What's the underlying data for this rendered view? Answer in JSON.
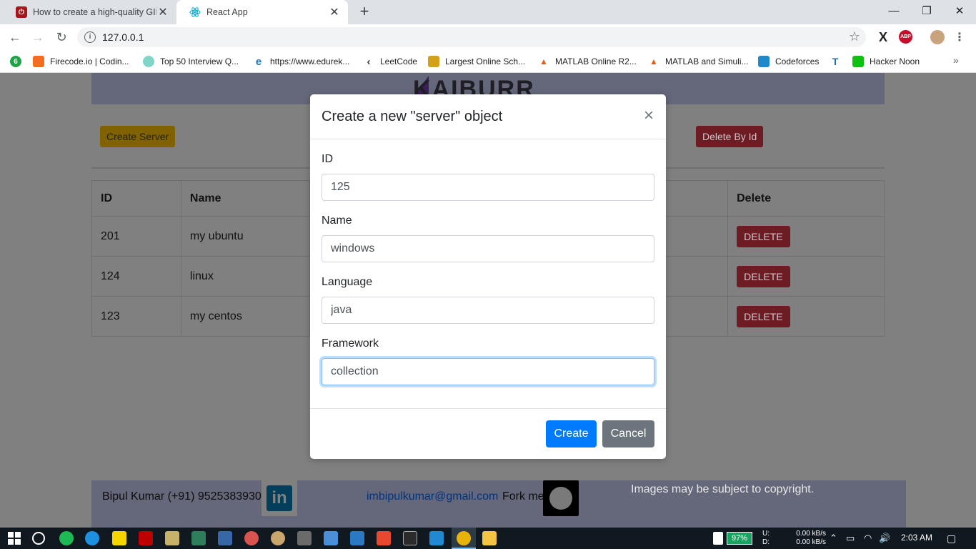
{
  "browser": {
    "tabs": [
      {
        "title": "How to create a high-quality GIF",
        "icon": "powered-by-icon",
        "close": "✕"
      },
      {
        "title": "React App",
        "icon": "react-icon",
        "close": "✕"
      }
    ],
    "new_tab": "+",
    "window_controls": {
      "minimize": "—",
      "maximize": "❐",
      "close": "✕"
    },
    "nav": {
      "back": "←",
      "forward": "→",
      "reload": "↻"
    },
    "url": "127.0.0.1",
    "bookmarks": [
      {
        "label": "",
        "icon": "badge-icon",
        "color": "#1ea446",
        "glyph": "6"
      },
      {
        "label": "Firecode.io | Codin...",
        "icon": "flame-icon",
        "color": "#f36c21",
        "glyph": "🔥"
      },
      {
        "label": "Top 50 Interview Q...",
        "icon": "leaf-icon",
        "color": "#7fd6c8",
        "glyph": "☁"
      },
      {
        "label": "https://www.edurek...",
        "icon": "edureka-icon",
        "color": "#1b75bc",
        "glyph": "e"
      },
      {
        "label": "LeetCode",
        "icon": "leetcode-icon",
        "color": "#3a3a3a",
        "glyph": "‹"
      },
      {
        "label": "Largest Online Sch...",
        "icon": "graduation-cap-icon",
        "color": "#d4a017",
        "glyph": "🎓"
      },
      {
        "label": "MATLAB Online R2...",
        "icon": "matlab-icon",
        "color": "#e35f1c",
        "glyph": "▲"
      },
      {
        "label": "MATLAB and Simuli...",
        "icon": "matlab-icon",
        "color": "#e35f1c",
        "glyph": "▲"
      },
      {
        "label": "Codeforces",
        "icon": "codeforces-icon",
        "color": "#1f8acb",
        "glyph": "▮"
      },
      {
        "label": "",
        "icon": "t2-icon",
        "color": "#1f6fb2",
        "glyph": "T"
      },
      {
        "label": "Hacker Noon",
        "icon": "hacker-noon-icon",
        "color": "#12c012",
        "glyph": "⌂"
      }
    ],
    "bookmarks_more": "»"
  },
  "page": {
    "logo_text": "KAIBURR",
    "create_server_button": "Create Server",
    "delete_by_id_button": "Delete By Id",
    "table": {
      "headers": [
        "ID",
        "Name",
        "",
        "Delete"
      ],
      "rows": [
        {
          "id": "201",
          "name": "my ubuntu",
          "action": "DELETE"
        },
        {
          "id": "124",
          "name": "linux",
          "action": "DELETE"
        },
        {
          "id": "123",
          "name": "my centos",
          "action": "DELETE"
        }
      ]
    },
    "footer": {
      "author": "Bipul Kumar (+91) 9525383930",
      "linkedin_glyph": "in",
      "email": "imbipulkumar@gmail.com",
      "fork_text": "Fork me",
      "copyright_note": "Images may be subject to copyright."
    }
  },
  "modal": {
    "title": "Create a new \"server\" object",
    "close": "×",
    "fields": [
      {
        "label": "ID",
        "value": "125"
      },
      {
        "label": "Name",
        "value": "windows"
      },
      {
        "label": "Language",
        "value": "java"
      },
      {
        "label": "Framework",
        "value": "collection"
      }
    ],
    "create_button": "Create",
    "cancel_button": "Cancel"
  },
  "taskbar": {
    "battery": "97%",
    "net_labels": "U:\nD:",
    "upload_rate": "0.00 kB/s",
    "download_rate": "0.00 kB/s",
    "time": "2:03 AM",
    "apps": [
      "spotify-icon",
      "edge-icon",
      "sticky-notes-icon",
      "filezilla-icon",
      "paint-icon",
      "task-icon",
      "remote-icon",
      "photos-icon",
      "paint3d-icon",
      "keyboard-icon",
      "calculator-icon",
      "vb-icon",
      "office-icon",
      "cmd-icon",
      "vscode-icon",
      "chrome-icon",
      "file-explorer-icon"
    ]
  }
}
